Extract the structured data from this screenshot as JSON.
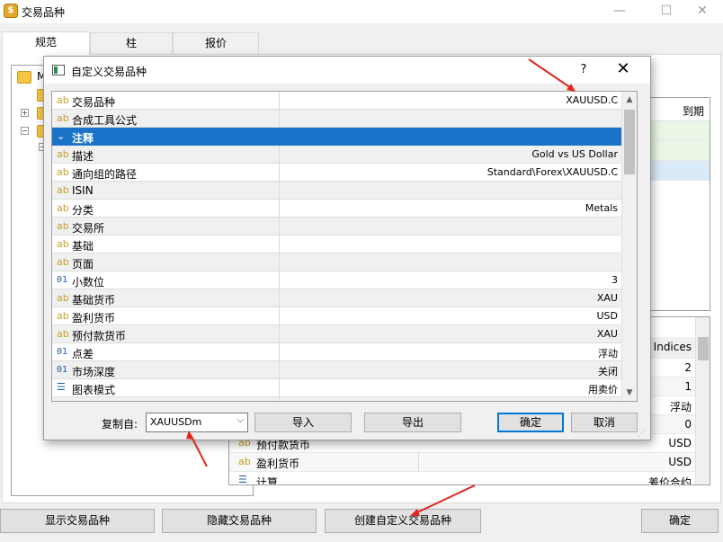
{
  "window": {
    "title": "交易品种",
    "minimize_glyph": "—",
    "maximize_glyph": "☐",
    "close_glyph": "✕"
  },
  "tabs": [
    {
      "label": "规范",
      "active": true
    },
    {
      "label": "柱",
      "active": false
    },
    {
      "label": "报价",
      "active": false
    }
  ],
  "tree": {
    "root_label": "M"
  },
  "right_list": {
    "header_right": "到期"
  },
  "properties_panel": {
    "header_value": "Indices",
    "rows": [
      {
        "name": "",
        "value": "2"
      },
      {
        "name": "",
        "value": "1"
      },
      {
        "name": "",
        "value": "浮动"
      },
      {
        "name": "",
        "value": "0"
      },
      {
        "icon": "ab",
        "name": "预付款货币",
        "value": "USD"
      },
      {
        "icon": "ab",
        "name": "盈利货币",
        "value": "USD"
      },
      {
        "icon": "list",
        "name": "计算",
        "value": "差价合约"
      }
    ]
  },
  "bottom_buttons": {
    "show": "显示交易品种",
    "hide": "隐藏交易品种",
    "create": "创建自定义交易品种",
    "ok": "确定"
  },
  "dialog": {
    "title": "自定义交易品种",
    "help": "?",
    "close": "✕",
    "rows": [
      {
        "icon": "ab",
        "name": "交易品种",
        "value": "XAUUSD.C"
      },
      {
        "icon": "ab",
        "name": "合成工具公式",
        "value": ""
      },
      {
        "icon": "chevron",
        "name": "注释",
        "value": "",
        "selected": true
      },
      {
        "icon": "ab",
        "name": "描述",
        "value": "Gold vs US Dollar"
      },
      {
        "icon": "ab",
        "name": "通向组的路径",
        "value": "Standard\\Forex\\XAUUSD.C"
      },
      {
        "icon": "ab",
        "name": "ISIN",
        "value": ""
      },
      {
        "icon": "ab",
        "name": "分类",
        "value": "Metals"
      },
      {
        "icon": "ab",
        "name": "交易所",
        "value": ""
      },
      {
        "icon": "ab",
        "name": "基础",
        "value": ""
      },
      {
        "icon": "ab",
        "name": "页面",
        "value": ""
      },
      {
        "icon": "01",
        "name": "小数位",
        "value": "3"
      },
      {
        "icon": "ab",
        "name": "基础货币",
        "value": "XAU"
      },
      {
        "icon": "ab",
        "name": "盈利货币",
        "value": "USD"
      },
      {
        "icon": "ab",
        "name": "预付款货币",
        "value": "XAU"
      },
      {
        "icon": "01",
        "name": "点差",
        "value": "浮动"
      },
      {
        "icon": "01",
        "name": "市场深度",
        "value": "关闭"
      },
      {
        "icon": "list",
        "name": "图表模式",
        "value": "用卖价"
      },
      {
        "icon": "01",
        "name": "…",
        "value": ""
      }
    ],
    "copy_from_label": "复制自:",
    "copy_from_value": "XAUUSDm",
    "import_label": "导入",
    "export_label": "导出",
    "ok_label": "确定",
    "cancel_label": "取消"
  },
  "colors": {
    "selection": "#1a73c8",
    "annotation_arrow": "#e0281f",
    "icon_text": "#c7a02a",
    "icon_numeric": "#1f5aa8"
  }
}
